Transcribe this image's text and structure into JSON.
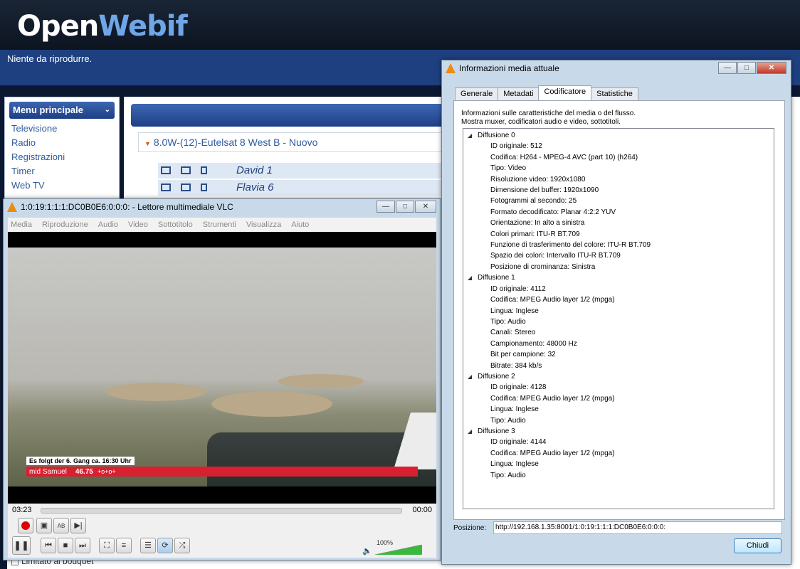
{
  "openwebif": {
    "logo_part1": "Open",
    "logo_part2": "Webif",
    "status": "Niente da riprodurre.",
    "menu_title": "Menu principale",
    "menu_items": [
      "Televisione",
      "Radio",
      "Registrazioni",
      "Timer",
      "Web TV"
    ],
    "bouquet": "8.0W-(12)-Eutelsat 8 West B - Nuovo",
    "channels": [
      "David 1",
      "Flavia 6"
    ],
    "bottom_checkbox": "Limitato ai bouquet"
  },
  "vlc": {
    "title": "1:0:19:1:1:1:DC0B0E6:0:0:0: - Lettore multimediale VLC",
    "menu": [
      "Media",
      "Riproduzione",
      "Audio",
      "Video",
      "Sottotitolo",
      "Strumenti",
      "Visualizza",
      "Aiuto"
    ],
    "overlay_line1": "Es folgt der 6. Gang ca. 16:30 Uhr",
    "overlay_name": "mid Samuel",
    "overlay_score": "46.75",
    "overlay_symbols": "+o+o+",
    "time_elapsed": "03:23",
    "time_remaining": "00:00",
    "volume": "100%",
    "volume_level": 1.0
  },
  "info": {
    "title": "Informazioni media attuale",
    "tabs": [
      "Generale",
      "Metadati",
      "Codificatore",
      "Statistiche"
    ],
    "active_tab": "Codificatore",
    "desc_line1": "Informazioni sulle caratteristiche del media o del flusso.",
    "desc_line2": "Mostra muxer, codificatori audio e video, sottotitoli.",
    "streams": [
      {
        "name": "Diffusione 0",
        "items": [
          "ID originale: 512",
          "Codifica: H264 - MPEG-4 AVC (part 10) (h264)",
          "Tipo: Video",
          "Risoluzione video: 1920x1080",
          "Dimensione del buffer: 1920x1090",
          "Fotogrammi al secondo: 25",
          "Formato decodificato: Planar 4:2:2 YUV",
          "Orientazione: In alto a sinistra",
          "Colori primari: ITU-R BT.709",
          "Funzione di trasferimento del colore: ITU-R BT.709",
          "Spazio dei colori: Intervallo ITU-R BT.709",
          "Posizione di crominanza: Sinistra"
        ]
      },
      {
        "name": "Diffusione 1",
        "items": [
          "ID originale: 4112",
          "Codifica: MPEG Audio layer 1/2 (mpga)",
          "Lingua: Inglese",
          "Tipo: Audio",
          "Canali: Stereo",
          "Campionamento: 48000 Hz",
          "Bit per campione: 32",
          "Bitrate: 384 kb/s"
        ]
      },
      {
        "name": "Diffusione 2",
        "items": [
          "ID originale: 4128",
          "Codifica: MPEG Audio layer 1/2 (mpga)",
          "Lingua: Inglese",
          "Tipo: Audio"
        ]
      },
      {
        "name": "Diffusione 3",
        "items": [
          "ID originale: 4144",
          "Codifica: MPEG Audio layer 1/2 (mpga)",
          "Lingua: Inglese",
          "Tipo: Audio"
        ]
      }
    ],
    "position_label": "Posizione:",
    "position_value": "http://192.168.1.35:8001/1:0:19:1:1:1:DC0B0E6:0:0:0:",
    "close_label": "Chiudi"
  }
}
